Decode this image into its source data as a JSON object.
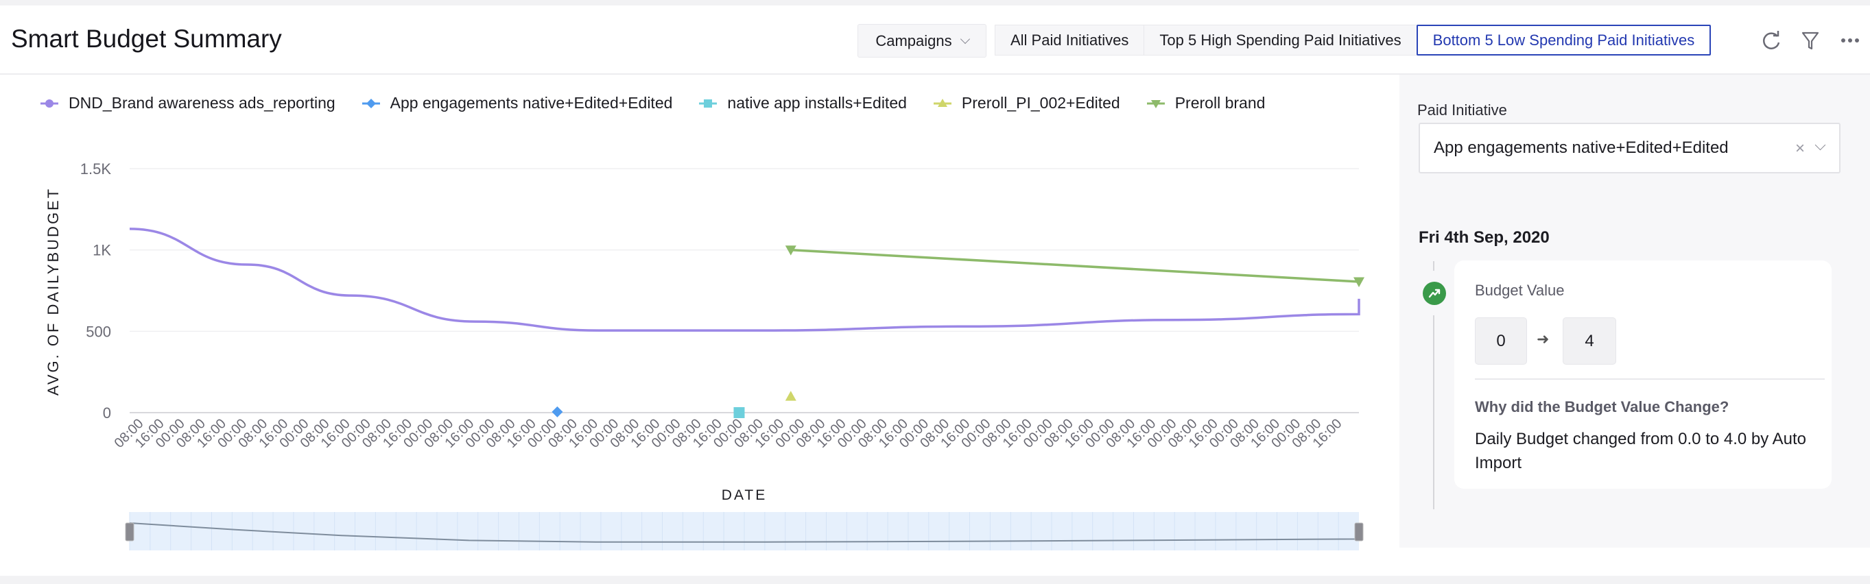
{
  "header": {
    "title": "Smart Budget Summary",
    "campaigns_dropdown": "Campaigns",
    "segments": [
      {
        "label": "All Paid Initiatives",
        "active": false
      },
      {
        "label": "Top 5 High Spending Paid Initiatives",
        "active": false
      },
      {
        "label": "Bottom 5 Low Spending Paid Initiatives",
        "active": true
      }
    ],
    "icons": [
      "refresh-icon",
      "filter-icon",
      "more-icon"
    ]
  },
  "side_panel": {
    "field_label": "Paid Initiative",
    "selected_value": "App engagements native+Edited+Edited",
    "clear_glyph": "×",
    "date": "Fri 4th Sep, 2020",
    "event": {
      "title": "Budget Value",
      "from_value": "0",
      "arrow": "➜",
      "to_value": "4",
      "why_title": "Why did the Budget Value Change?",
      "reason": "Daily Budget changed from 0.0 to 4.0 by Auto Import"
    }
  },
  "colors": {
    "purple": "#9b87e6",
    "blue": "#4f9bef",
    "cyan": "#6dcfdc",
    "yellow": "#cfd66a",
    "green": "#8dba6a",
    "accent": "#2a44b8"
  },
  "chart_data": {
    "type": "line",
    "title": "",
    "xlabel": "DATE",
    "ylabel": "AVG. OF DAILYBUDGET",
    "ylim": [
      0,
      1500
    ],
    "yticks": [
      0,
      500,
      1000,
      1500
    ],
    "ytick_labels": [
      "0",
      "500",
      "1K",
      "1.5K"
    ],
    "grid": true,
    "legend_position": "top-left",
    "x_tick_count": 59,
    "x_tick_cycle": [
      "08:00",
      "16:00",
      "00:00"
    ],
    "series": [
      {
        "name": "DND_Brand awareness ads_reporting",
        "color": "#9b87e6",
        "marker": "circle",
        "points": [
          [
            0,
            1130
          ],
          [
            5,
            910
          ],
          [
            10,
            720
          ],
          [
            16,
            560
          ],
          [
            22,
            505
          ],
          [
            30,
            505
          ],
          [
            40,
            530
          ],
          [
            50,
            570
          ],
          [
            58.8,
            605
          ],
          [
            59,
            700
          ]
        ]
      },
      {
        "name": "App engagements native+Edited+Edited",
        "color": "#4f9bef",
        "marker": "diamond",
        "points": [
          [
            20,
            5
          ]
        ]
      },
      {
        "name": "native app installs+Edited",
        "color": "#6dcfdc",
        "marker": "square",
        "points": [
          [
            28.8,
            0
          ]
        ]
      },
      {
        "name": "Preroll_PI_002+Edited",
        "color": "#cfd66a",
        "marker": "triangle",
        "points": [
          [
            31.3,
            100
          ]
        ]
      },
      {
        "name": "Preroll brand",
        "color": "#8dba6a",
        "marker": "triangle-down",
        "points": [
          [
            31.3,
            1000
          ],
          [
            58.7,
            805
          ]
        ]
      }
    ]
  }
}
